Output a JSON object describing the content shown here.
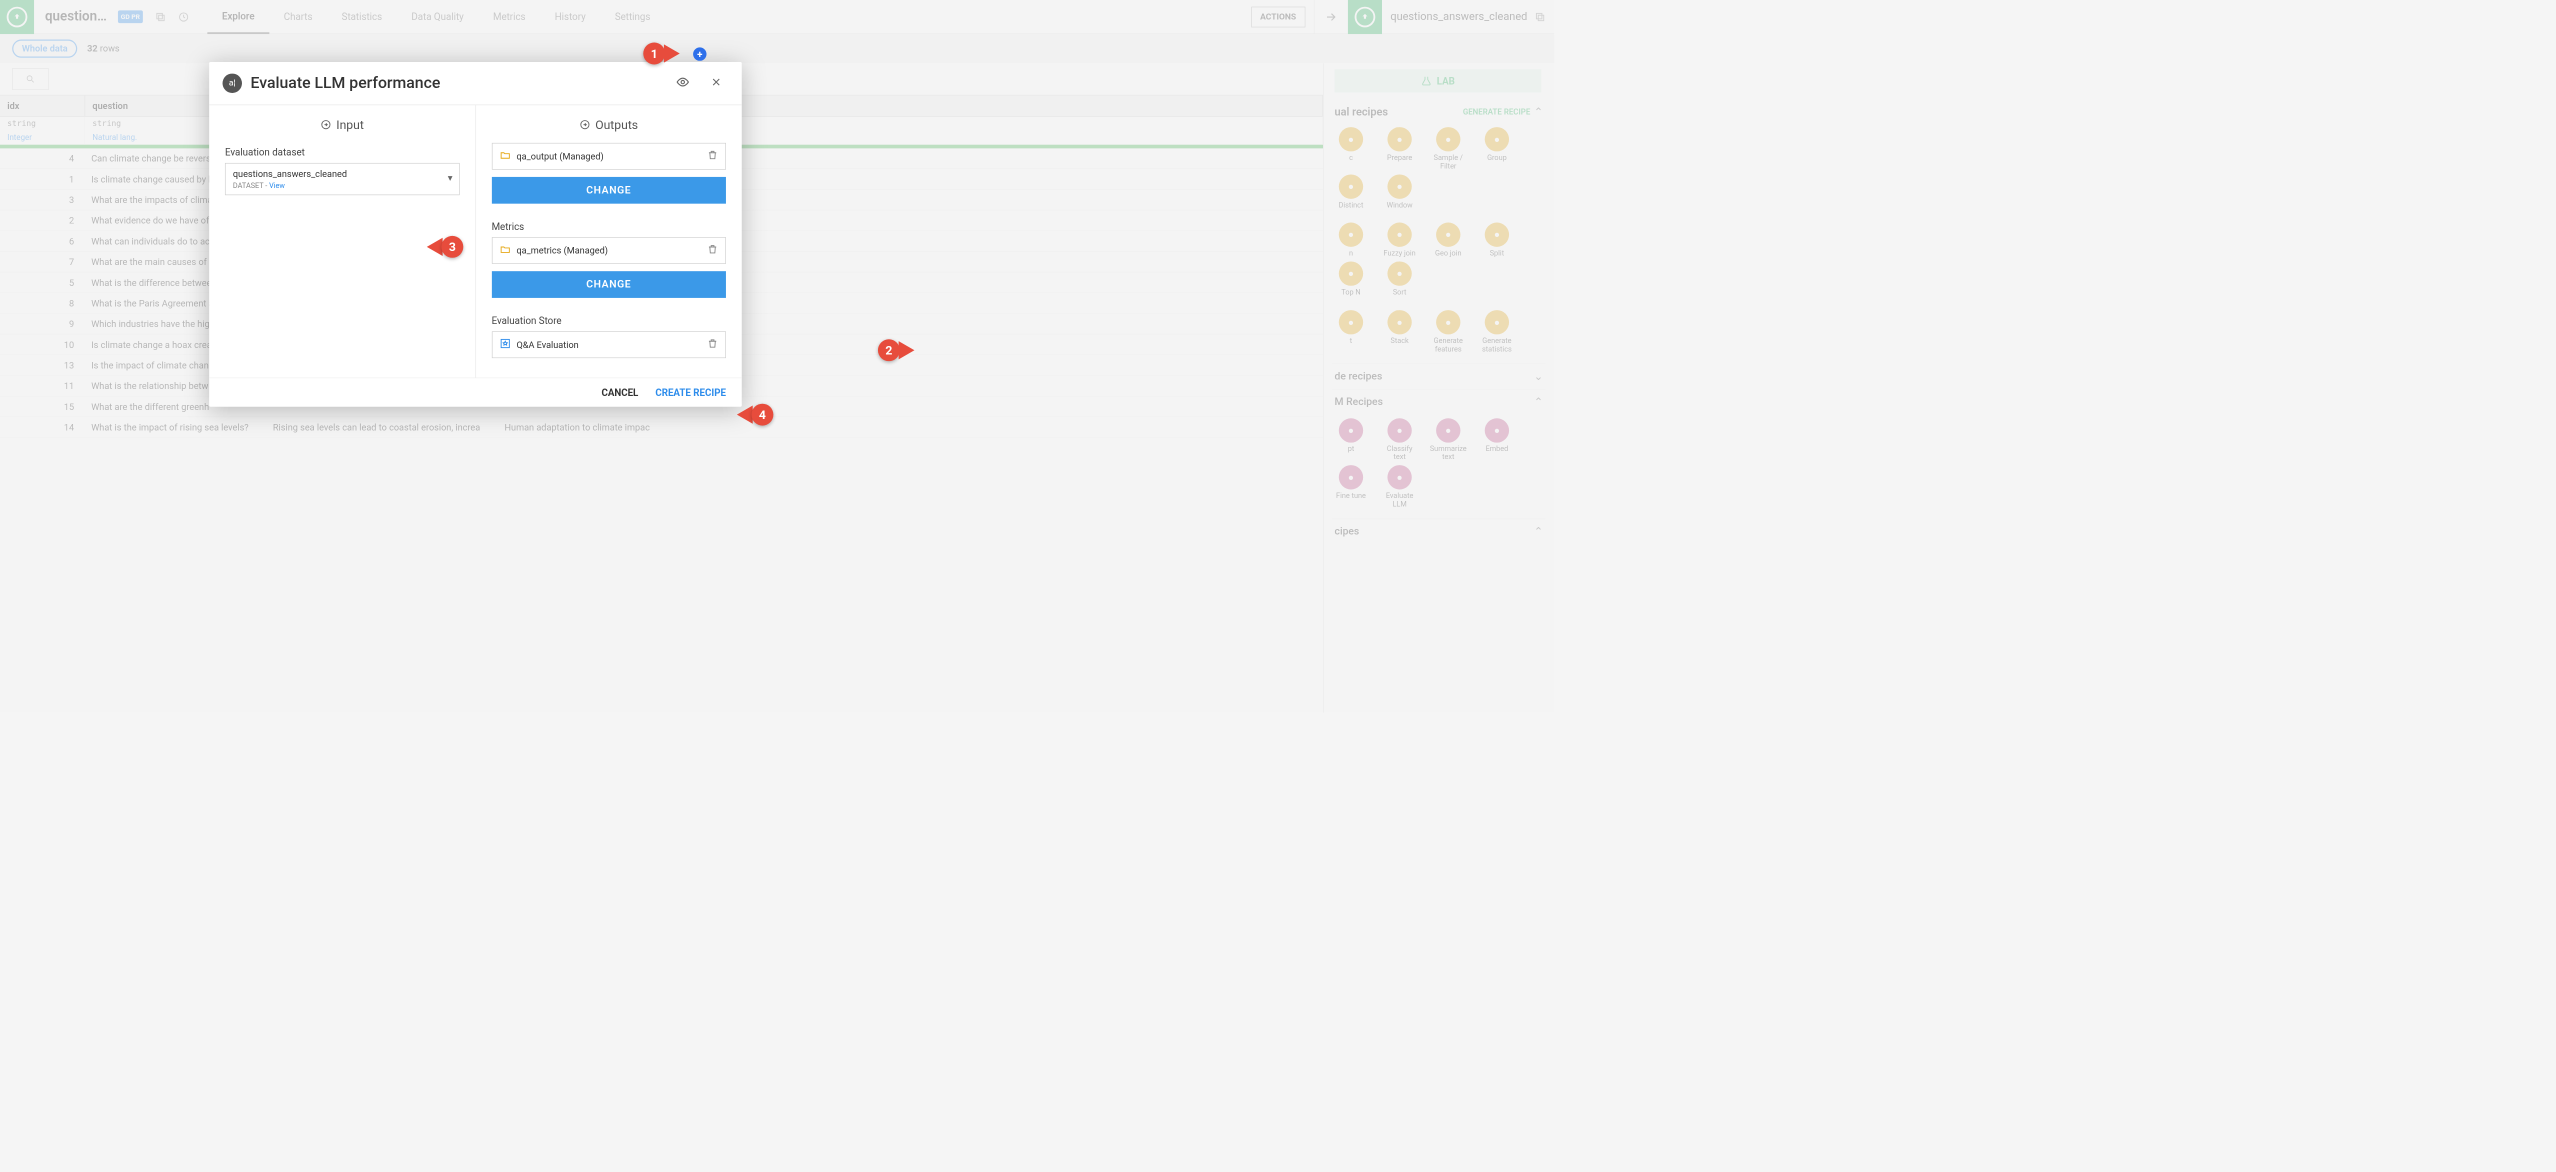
{
  "header": {
    "breadcrumb": "question…",
    "gdpr_badge": "GD\nPR",
    "tabs": [
      "Explore",
      "Charts",
      "Statistics",
      "Data Quality",
      "Metrics",
      "History",
      "Settings"
    ],
    "active_tab": 0,
    "actions_label": "ACTIONS",
    "right_dataset": "questions_answers_cleaned"
  },
  "subbar": {
    "filter_pill": "Whole data",
    "row_count_num": "32",
    "row_count_suffix": " rows"
  },
  "grid": {
    "columns": [
      {
        "name": "idx",
        "type": "string",
        "link": "Integer"
      },
      {
        "name": "question",
        "type": "string",
        "link": "Natural lang."
      }
    ],
    "rows": [
      {
        "idx": "4",
        "q": "Can climate change be reversed?"
      },
      {
        "idx": "1",
        "q": "Is climate change caused by h"
      },
      {
        "idx": "3",
        "q": "What are the impacts of clima"
      },
      {
        "idx": "2",
        "q": "What evidence do we have of"
      },
      {
        "idx": "6",
        "q": "What can individuals do to ac"
      },
      {
        "idx": "7",
        "q": "What are the main causes of c"
      },
      {
        "idx": "5",
        "q": "What is the difference betwee"
      },
      {
        "idx": "8",
        "q": "What is the Paris Agreement a"
      },
      {
        "idx": "9",
        "q": "Which industries have the hig"
      },
      {
        "idx": "10",
        "q": "Is climate change a hoax crea"
      },
      {
        "idx": "13",
        "q": "Is the impact of climate chan"
      },
      {
        "idx": "11",
        "q": "What is the relationship betw"
      },
      {
        "idx": "15",
        "q": "What are the different greenh"
      },
      {
        "idx": "14",
        "q": "What is the impact of rising sea levels?"
      }
    ],
    "extra_cells": [
      "Rising sea levels can lead to coastal erosion, increa",
      "Human adaptation to climate impac"
    ]
  },
  "right_panel": {
    "lab_label": "LAB",
    "section_visual": "ual recipes",
    "generate_link": "GENERATE RECIPE",
    "visual_recipes_row1": [
      {
        "label": "c",
        "icon": "sync"
      },
      {
        "label": "Prepare",
        "icon": "broom"
      },
      {
        "label": "Sample / Filter",
        "icon": "funnel"
      },
      {
        "label": "Group",
        "icon": "group"
      },
      {
        "label": "Distinct",
        "icon": "neq"
      },
      {
        "label": "Window",
        "icon": "window"
      }
    ],
    "visual_recipes_row2": [
      {
        "label": "n",
        "icon": "join"
      },
      {
        "label": "Fuzzy join",
        "icon": "fuzzy"
      },
      {
        "label": "Geo join",
        "icon": "geo"
      },
      {
        "label": "Split",
        "icon": "split"
      },
      {
        "label": "Top N",
        "icon": "topn"
      },
      {
        "label": "Sort",
        "icon": "sort"
      }
    ],
    "visual_recipes_row3": [
      {
        "label": "t",
        "icon": "stack1"
      },
      {
        "label": "Stack",
        "icon": "stack"
      },
      {
        "label": "Generate features",
        "icon": "gen"
      },
      {
        "label": "Generate statistics",
        "icon": "stats"
      }
    ],
    "section_code": "de recipes",
    "section_llm": "M Recipes",
    "llm_recipes": [
      {
        "label": "pt",
        "icon": "prompt"
      },
      {
        "label": "Classify text",
        "icon": "classify"
      },
      {
        "label": "Summarize text",
        "icon": "summarize"
      },
      {
        "label": "Embed",
        "icon": "embed"
      },
      {
        "label": "Fine tune",
        "icon": "finetune"
      },
      {
        "label": "Evaluate LLM",
        "icon": "eval"
      }
    ],
    "section_other": "cipes"
  },
  "modal": {
    "title": "Evaluate LLM performance",
    "input_header": "Input",
    "outputs_header": "Outputs",
    "eval_dataset_label": "Evaluation dataset",
    "eval_dataset_value": "questions_answers_cleaned",
    "eval_dataset_sub_prefix": "DATASET - ",
    "eval_dataset_view": "View",
    "output1_name": "qa_output (Managed)",
    "change_label": "CHANGE",
    "metrics_label": "Metrics",
    "metrics_name": "qa_metrics (Managed)",
    "eval_store_label": "Evaluation Store",
    "eval_store_name": "Q&A Evaluation",
    "cancel_label": "CANCEL",
    "create_label": "CREATE RECIPE"
  },
  "callouts": {
    "c1": "1",
    "c2": "2",
    "c3": "3",
    "c4": "4"
  }
}
